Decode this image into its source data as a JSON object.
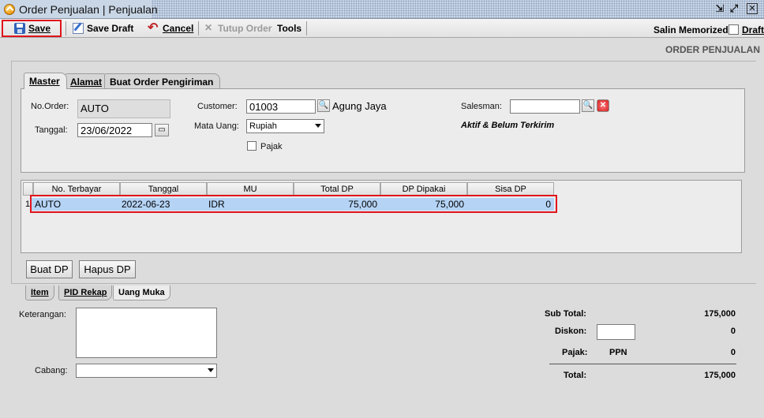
{
  "window": {
    "title": "Order Penjualan | Penjualan",
    "controls": {
      "restore": "⇲",
      "maximize": "⤢",
      "close": "✕"
    }
  },
  "toolbar": {
    "save": "Save",
    "save_draft": "Save Draft",
    "cancel": "Cancel",
    "tutup_order": "Tutup Order",
    "tools": "Tools",
    "salin_memorized": "Salin Memorized",
    "draft": "Draft",
    "draft_checked": false
  },
  "form_title": "ORDER PENJUALAN",
  "tabs": [
    {
      "label": "Master",
      "active": true
    },
    {
      "label": "Alamat",
      "active": false
    },
    {
      "label": "Buat Order Pengiriman",
      "active": false
    }
  ],
  "master": {
    "no_order_label": "No.Order:",
    "no_order_value": "AUTO",
    "tanggal_label": "Tanggal:",
    "tanggal_value": "23/06/2022",
    "customer_label": "Customer:",
    "customer_code": "01003",
    "customer_name": "Agung Jaya",
    "mata_uang_label": "Mata Uang:",
    "mata_uang_value": "Rupiah",
    "pajak_label": "Pajak",
    "pajak_checked": false,
    "salesman_label": "Salesman:",
    "salesman_value": "",
    "status_text": "Aktif & Belum Terkirim"
  },
  "dp_grid": {
    "columns": [
      "No. Terbayar",
      "Tanggal",
      "MU",
      "Total DP",
      "DP Dipakai",
      "Sisa DP"
    ],
    "rows": [
      {
        "row_no": "1",
        "no_terbayar": "AUTO",
        "tanggal": "2022-06-23",
        "mu": "IDR",
        "total_dp": "75,000",
        "dp_dipakai": "75,000",
        "sisa_dp": "0"
      }
    ]
  },
  "dp_buttons": {
    "buat_dp": "Buat DP",
    "hapus_dp": "Hapus DP"
  },
  "bottom_tabs": [
    {
      "label": "Item",
      "active": false
    },
    {
      "label": "PID Rekap",
      "active": false
    },
    {
      "label": "Uang Muka",
      "active": true
    }
  ],
  "footer": {
    "keterangan_label": "Keterangan:",
    "keterangan_value": "",
    "cabang_label": "Cabang:",
    "cabang_value": "",
    "sub_total_label": "Sub Total:",
    "sub_total_value": "175,000",
    "diskon_label": "Diskon:",
    "diskon_input": "",
    "diskon_value": "0",
    "pajak_label": "Pajak:",
    "pajak_type": "PPN",
    "pajak_value": "0",
    "total_label": "Total:",
    "total_value": "175,000"
  },
  "colors": {
    "highlight": "#e0141c",
    "selected_row": "#b5d3f5"
  }
}
